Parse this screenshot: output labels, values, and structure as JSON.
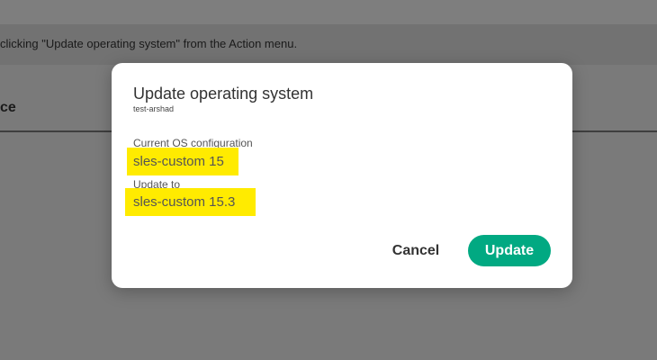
{
  "background": {
    "banner_text": "clicking \"Update operating system\" from the Action menu.",
    "column_header": "ce"
  },
  "modal": {
    "title": "Update operating system",
    "subtitle": "test-arshad",
    "current_label": "Current OS configuration",
    "current_value": "sles-custom 15",
    "update_label": "Update to",
    "update_value": "sles-custom 15.3",
    "cancel_label": "Cancel",
    "update_button_label": "Update"
  },
  "colors": {
    "accent": "#01a982",
    "highlight": "#ffeb00",
    "overlay": "#7a7a7a"
  }
}
